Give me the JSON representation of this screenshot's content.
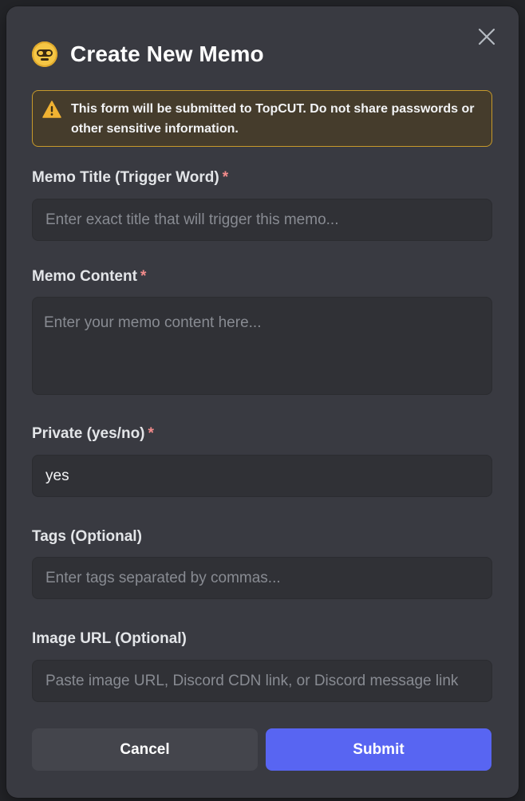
{
  "modal": {
    "title": "Create New Memo",
    "logo_icon": "sloth-face-icon",
    "close_icon": "close-icon"
  },
  "warning": {
    "icon": "warning-triangle-icon",
    "text": "This form will be submitted to TopCUT. Do not share passwords or other sensitive information."
  },
  "fields": {
    "memo_title": {
      "label": "Memo Title (Trigger Word)",
      "required_mark": "*",
      "value": "",
      "placeholder": "Enter exact title that will trigger this memo..."
    },
    "memo_content": {
      "label": "Memo Content",
      "required_mark": "*",
      "value": "",
      "placeholder": "Enter your memo content here..."
    },
    "private": {
      "label": "Private (yes/no)",
      "required_mark": "*",
      "value": "yes",
      "placeholder": ""
    },
    "tags": {
      "label": "Tags (Optional)",
      "value": "",
      "placeholder": "Enter tags separated by commas..."
    },
    "image_url": {
      "label": "Image URL (Optional)",
      "value": "",
      "placeholder": "Paste image URL, Discord CDN link, or Discord message link"
    }
  },
  "buttons": {
    "cancel_label": "Cancel",
    "submit_label": "Submit"
  },
  "colors": {
    "accent": "#5865f2",
    "warning_border": "#c79a2b",
    "required": "#f38b8b"
  }
}
